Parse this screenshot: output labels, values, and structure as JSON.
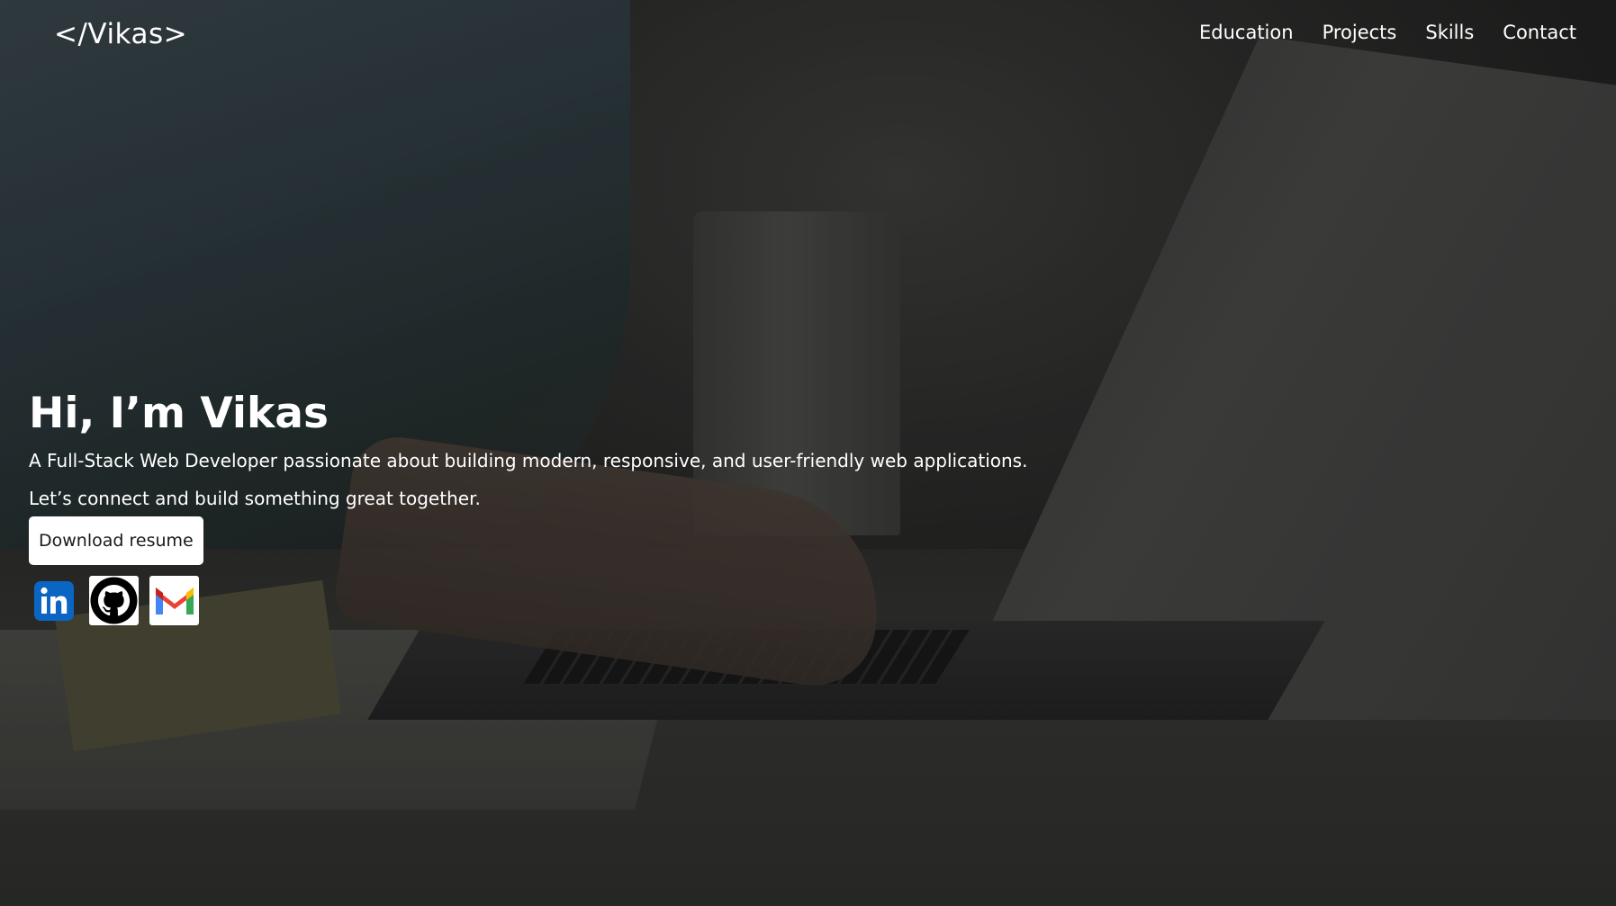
{
  "header": {
    "logo": "</Vikas>",
    "nav": [
      {
        "label": "Education"
      },
      {
        "label": "Projects"
      },
      {
        "label": "Skills"
      },
      {
        "label": "Contact"
      }
    ]
  },
  "hero": {
    "headline": "Hi, I’m Vikas",
    "subtitle": "A Full-Stack Web Developer passionate about building modern, responsive, and user-friendly web applications.",
    "subtitle2": "Let’s connect and build something great together.",
    "resume_button": "Download resume"
  },
  "socials": [
    {
      "icon": "linkedin-icon",
      "color": "#0a66c2"
    },
    {
      "icon": "github-icon",
      "color": "#000000"
    },
    {
      "icon": "gmail-icon",
      "color": "#ea4335"
    }
  ]
}
